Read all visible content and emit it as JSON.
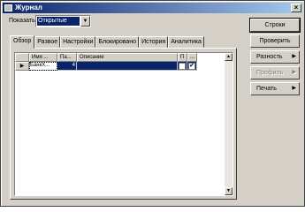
{
  "window": {
    "title": "Журнал",
    "close_glyph": "×"
  },
  "filter": {
    "label": "Показать",
    "value": "Открытые"
  },
  "tabs": [
    "Обзор",
    "Развое",
    "Настройки",
    "Блокировано",
    "История",
    "Аналитика"
  ],
  "grid": {
    "columns": [
      "Имя ...",
      "Па...",
      "Описание",
      "П",
      "..."
    ],
    "rows": [
      {
        "indicator": "▶",
        "name": "БанкХ...",
        "num": "4",
        "desc": "",
        "check1": "",
        "check2": "✔"
      }
    ]
  },
  "buttons": {
    "rows": "Строки",
    "check": "Проверить",
    "diff": "Разность",
    "profile": "Профиль",
    "print": "Печать"
  }
}
